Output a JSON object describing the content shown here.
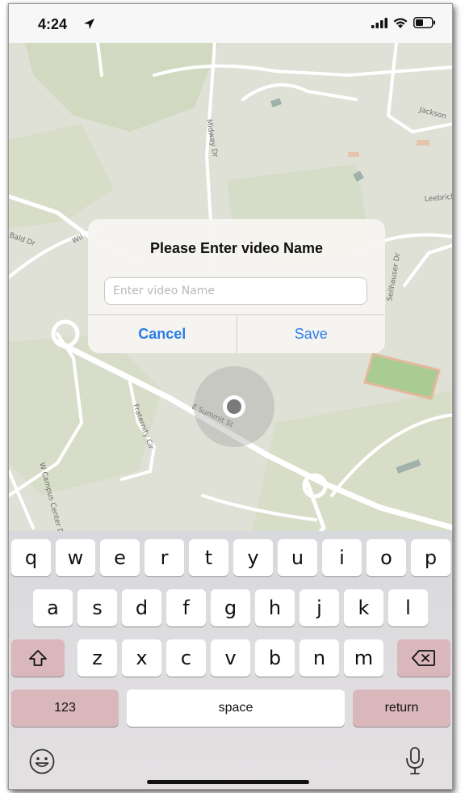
{
  "status_bar": {
    "time": "4:24"
  },
  "map": {
    "street_labels": [
      "Jackson",
      "Midway Dr",
      "Leebrick",
      "Bald Dr",
      "Wil",
      "Seilhauser Dr",
      "E Summit St",
      "Fraternity Cir",
      "W Campus Center Dr"
    ]
  },
  "dialog": {
    "title": "Please Enter video Name",
    "input_placeholder": "Enter video Name",
    "input_value": "",
    "cancel_label": "Cancel",
    "save_label": "Save",
    "accent_color": "#2a7ee9"
  },
  "keyboard": {
    "row1": [
      "q",
      "w",
      "e",
      "r",
      "t",
      "y",
      "u",
      "i",
      "o",
      "p"
    ],
    "row2": [
      "a",
      "s",
      "d",
      "f",
      "g",
      "h",
      "j",
      "k",
      "l"
    ],
    "row3": [
      "z",
      "x",
      "c",
      "v",
      "b",
      "n",
      "m"
    ],
    "numbers_label": "123",
    "space_label": "space",
    "return_label": "return",
    "shift_icon": "shift-icon",
    "delete_icon": "delete-icon",
    "emoji_icon": "emoji-icon",
    "dictation_icon": "microphone-icon"
  }
}
